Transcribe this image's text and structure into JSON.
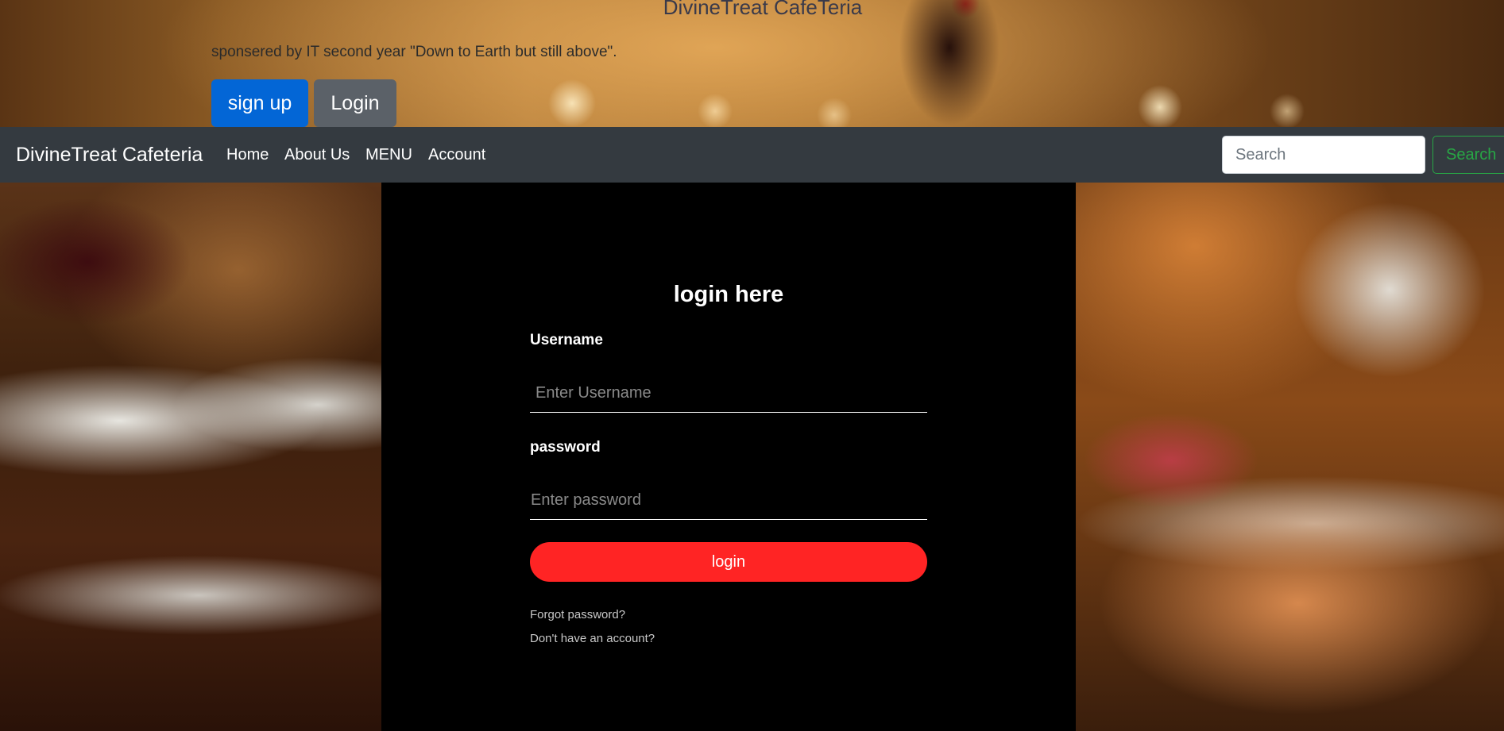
{
  "hero": {
    "title": "DivineTreat CafeTeria",
    "subtitle": "sponsered by IT second year \"Down to Earth but still above\".",
    "signup_label": "sign up",
    "login_label": "Login"
  },
  "navbar": {
    "brand": "DivineTreat Cafeteria",
    "links": [
      {
        "label": "Home"
      },
      {
        "label": "About Us"
      },
      {
        "label": "MENU"
      },
      {
        "label": "Account"
      }
    ],
    "search": {
      "placeholder": "Search",
      "value": "",
      "button_label": "Search"
    }
  },
  "login_form": {
    "title": "login here",
    "username_label": "Username",
    "username_placeholder": "Enter Username",
    "password_label": "password",
    "password_placeholder": "Enter password",
    "submit_label": "login",
    "forgot_label": "Forgot password?",
    "no_account_label": "Don't have an account?"
  },
  "colors": {
    "navbar_bg": "#343a40",
    "primary_button": "#0366d6",
    "secondary_button": "#5b6168",
    "search_accent": "#28a745",
    "login_button": "#ff2424",
    "panel_bg": "#000000"
  }
}
